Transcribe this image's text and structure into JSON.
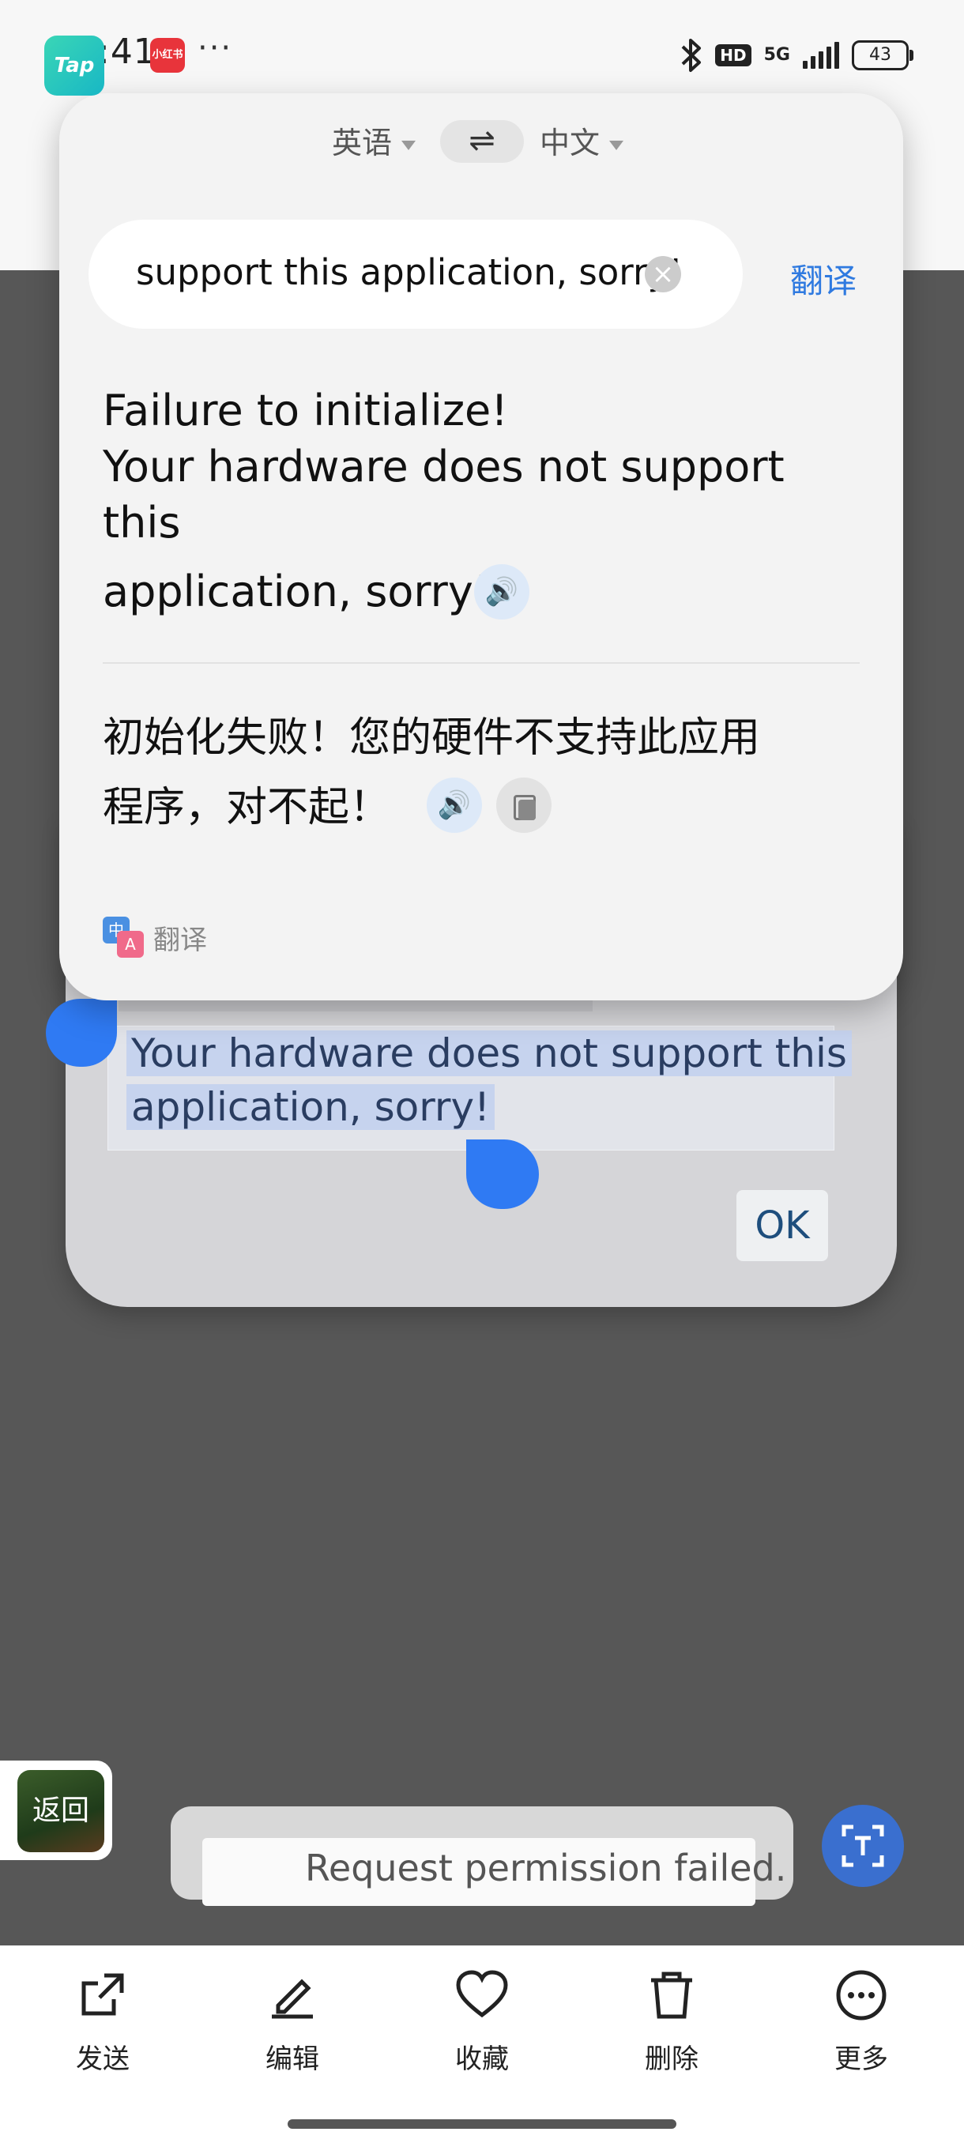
{
  "status_bar": {
    "time": "12:41",
    "app_badge": "小红书",
    "more_dots": "···",
    "bluetooth_icon": "bluetooth-icon",
    "hd_label": "HD",
    "network_label": "5G",
    "battery": "43"
  },
  "translate_card": {
    "source_lang": "英语",
    "target_lang": "中文",
    "swap_symbol": "⇌",
    "input_text": "support this application, sorry!",
    "translate_button": "翻译",
    "source_text_lines": [
      "Failure to initialize!",
      "Your hardware does not support this",
      "application, sorry!"
    ],
    "translated_lines": [
      "初始化失败！您的硬件不支持此应用",
      "程序，对不起！"
    ],
    "brand_label": "翻译",
    "brand_icon_a": "中",
    "brand_icon_b": "A"
  },
  "dialog": {
    "line1": "Your hardware does not support this",
    "line2": "application, sorry!",
    "ok_label": "OK"
  },
  "floating": {
    "back_label": "返回",
    "toast_icon_text": "Tap",
    "toast_text": "Request permission failed."
  },
  "toolbar": {
    "items": [
      {
        "label": "发送",
        "icon": "share-icon"
      },
      {
        "label": "编辑",
        "icon": "edit-icon"
      },
      {
        "label": "收藏",
        "icon": "heart-icon"
      },
      {
        "label": "删除",
        "icon": "trash-icon"
      },
      {
        "label": "更多",
        "icon": "more-icon"
      }
    ]
  }
}
